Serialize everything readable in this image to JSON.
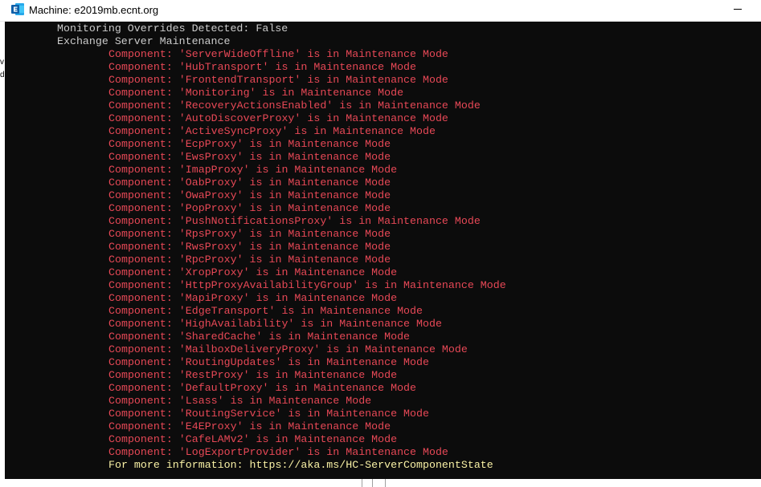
{
  "window": {
    "title": "Machine: e2019mb.ecnt.org",
    "icon": "exchange-app-icon",
    "minimize_icon": "minimize-icon"
  },
  "colors": {
    "console_bg": "#0c0c0c",
    "normal_text": "#cccccc",
    "warning_red": "#e74856",
    "info_yellow": "#f9f1a5"
  },
  "background_edge": {
    "chars": [
      "v",
      "d"
    ]
  },
  "console": {
    "header_lines": [
      "Monitoring Overrides Detected: False",
      "Exchange Server Maintenance"
    ],
    "component_lines": [
      "Component: 'ServerWideOffline' is in Maintenance Mode",
      "Component: 'HubTransport' is in Maintenance Mode",
      "Component: 'FrontendTransport' is in Maintenance Mode",
      "Component: 'Monitoring' is in Maintenance Mode",
      "Component: 'RecoveryActionsEnabled' is in Maintenance Mode",
      "Component: 'AutoDiscoverProxy' is in Maintenance Mode",
      "Component: 'ActiveSyncProxy' is in Maintenance Mode",
      "Component: 'EcpProxy' is in Maintenance Mode",
      "Component: 'EwsProxy' is in Maintenance Mode",
      "Component: 'ImapProxy' is in Maintenance Mode",
      "Component: 'OabProxy' is in Maintenance Mode",
      "Component: 'OwaProxy' is in Maintenance Mode",
      "Component: 'PopProxy' is in Maintenance Mode",
      "Component: 'PushNotificationsProxy' is in Maintenance Mode",
      "Component: 'RpsProxy' is in Maintenance Mode",
      "Component: 'RwsProxy' is in Maintenance Mode",
      "Component: 'RpcProxy' is in Maintenance Mode",
      "Component: 'XropProxy' is in Maintenance Mode",
      "Component: 'HttpProxyAvailabilityGroup' is in Maintenance Mode",
      "Component: 'MapiProxy' is in Maintenance Mode",
      "Component: 'EdgeTransport' is in Maintenance Mode",
      "Component: 'HighAvailability' is in Maintenance Mode",
      "Component: 'SharedCache' is in Maintenance Mode",
      "Component: 'MailboxDeliveryProxy' is in Maintenance Mode",
      "Component: 'RoutingUpdates' is in Maintenance Mode",
      "Component: 'RestProxy' is in Maintenance Mode",
      "Component: 'DefaultProxy' is in Maintenance Mode",
      "Component: 'Lsass' is in Maintenance Mode",
      "Component: 'RoutingService' is in Maintenance Mode",
      "Component: 'E4EProxy' is in Maintenance Mode",
      "Component: 'CafeLAMv2' is in Maintenance Mode",
      "Component: 'LogExportProvider' is in Maintenance Mode"
    ],
    "footer_line": "For more information: https://aka.ms/HC-ServerComponentState"
  }
}
